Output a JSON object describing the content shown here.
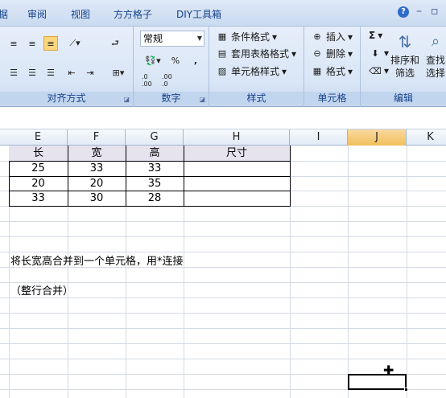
{
  "menu": {
    "tabs": [
      "据",
      "审阅",
      "视图",
      "方方格子",
      "DIY工具箱"
    ],
    "window_controls": [
      "?",
      "–",
      "▫",
      "×"
    ]
  },
  "ribbon": {
    "groups": {
      "alignment": "对齐方式",
      "number": "数字",
      "styles": "样式",
      "cells": "单元格",
      "editing": "编辑"
    },
    "number_format": "常规",
    "percent": "%",
    "comma": ",",
    "dec_inc": ".0 .00",
    "dec_dec": ".00 .0",
    "cond_format": "条件格式",
    "table_format": "套用表格格式",
    "cell_style": "单元格样式",
    "insert": "插入",
    "delete": "删除",
    "format": "格式",
    "sigma": "Σ",
    "sort_filter_l1": "排序和",
    "sort_filter_l2": "筛选",
    "find_select_l1": "查找",
    "find_select_l2": "选择"
  },
  "columns": [
    "E",
    "F",
    "G",
    "H",
    "I",
    "J",
    "K"
  ],
  "selected_column": "J",
  "table": {
    "headers": [
      "长",
      "宽",
      "高",
      "尺寸"
    ],
    "rows": [
      [
        "25",
        "33",
        "33",
        ""
      ],
      [
        "20",
        "20",
        "35",
        ""
      ],
      [
        "33",
        "30",
        "28",
        ""
      ]
    ]
  },
  "notes": {
    "line1": "将长宽高合并到一个单元格，用*连接",
    "line2": "（整行合并）"
  }
}
